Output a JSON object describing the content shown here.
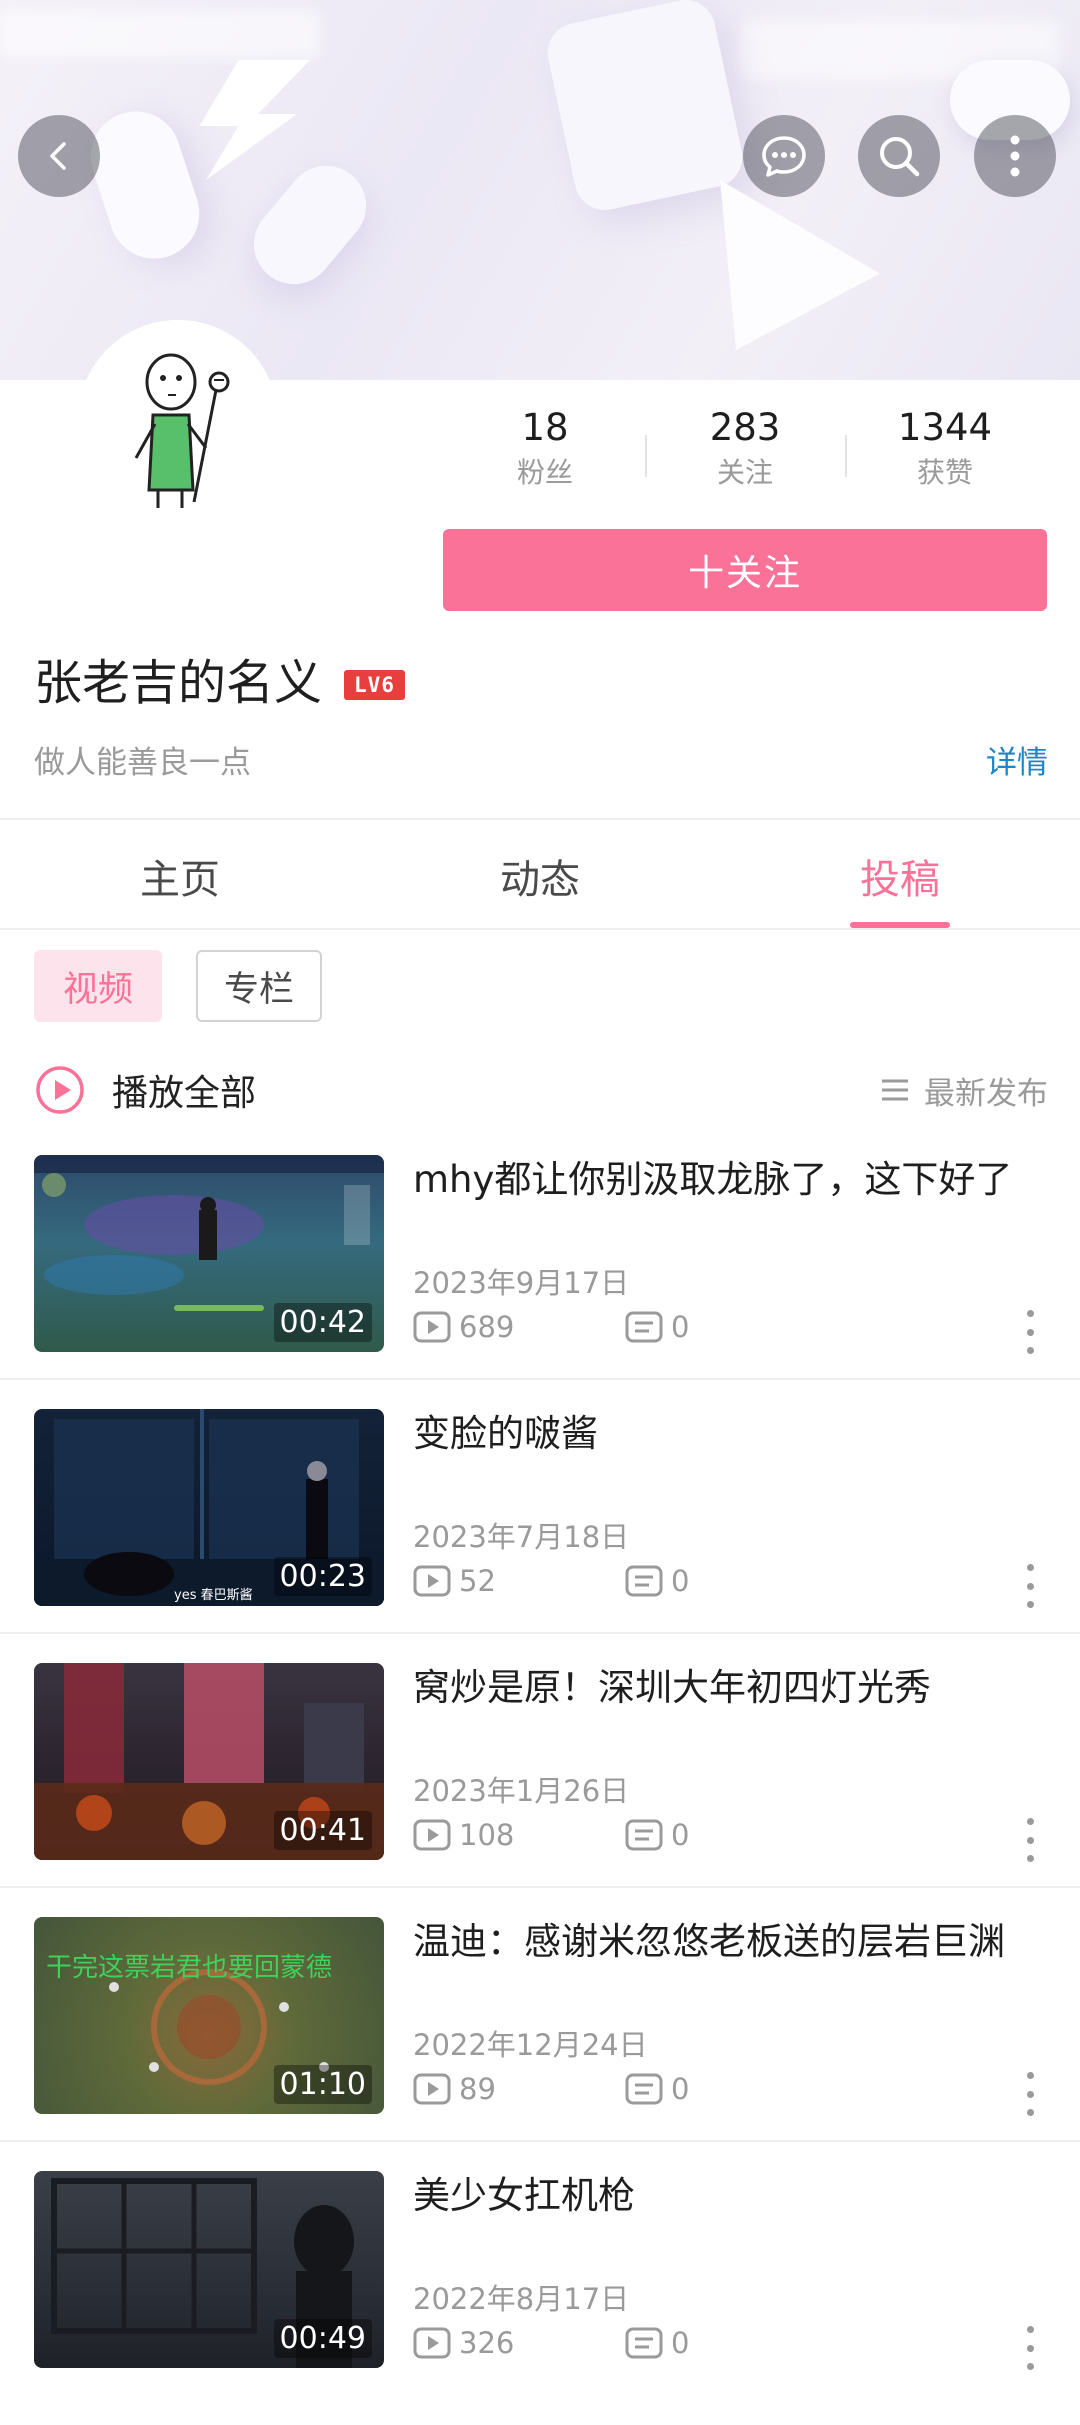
{
  "banner": {
    "back_icon": "back-arrow-icon",
    "message_icon": "message-bubble-icon",
    "search_icon": "search-icon",
    "more_icon": "more-vertical-icon"
  },
  "profile": {
    "stats": [
      {
        "value": "18",
        "label": "粉丝"
      },
      {
        "value": "283",
        "label": "关注"
      },
      {
        "value": "1344",
        "label": "获赞"
      }
    ],
    "follow_label": "十关注",
    "name": "张老吉的名义",
    "level": "LV6",
    "bio": "做人能善良一点",
    "detail_label": "详情"
  },
  "tabs": [
    {
      "label": "主页",
      "active": false
    },
    {
      "label": "动态",
      "active": false
    },
    {
      "label": "投稿",
      "active": true
    }
  ],
  "filters": {
    "video_label": "视频",
    "column_label": "专栏"
  },
  "playbar": {
    "play_all_label": "播放全部",
    "sort_label": "最新发布"
  },
  "colors": {
    "accent": "#fb7299",
    "link": "#1b86c9",
    "level_badge": "#e83e3e"
  },
  "videos": [
    {
      "title": "mhy都让你别汲取龙脉了，这下好了",
      "date": "2023年9月17日",
      "views": "689",
      "comments": "0",
      "duration": "00:42"
    },
    {
      "title": "变脸的啵酱",
      "date": "2023年7月18日",
      "views": "52",
      "comments": "0",
      "duration": "00:23",
      "caption": "yes 春巴斯酱"
    },
    {
      "title": "窝炒是原！深圳大年初四灯光秀",
      "date": "2023年1月26日",
      "views": "108",
      "comments": "0",
      "duration": "00:41"
    },
    {
      "title": "温迪：感谢米忽悠老板送的层岩巨渊",
      "date": "2022年12月24日",
      "views": "89",
      "comments": "0",
      "duration": "01:10",
      "overlay_text": "干完这票岩君也要回蒙德"
    },
    {
      "title": "美少女扛机枪",
      "date": "2022年8月17日",
      "views": "326",
      "comments": "0",
      "duration": "00:49"
    }
  ]
}
